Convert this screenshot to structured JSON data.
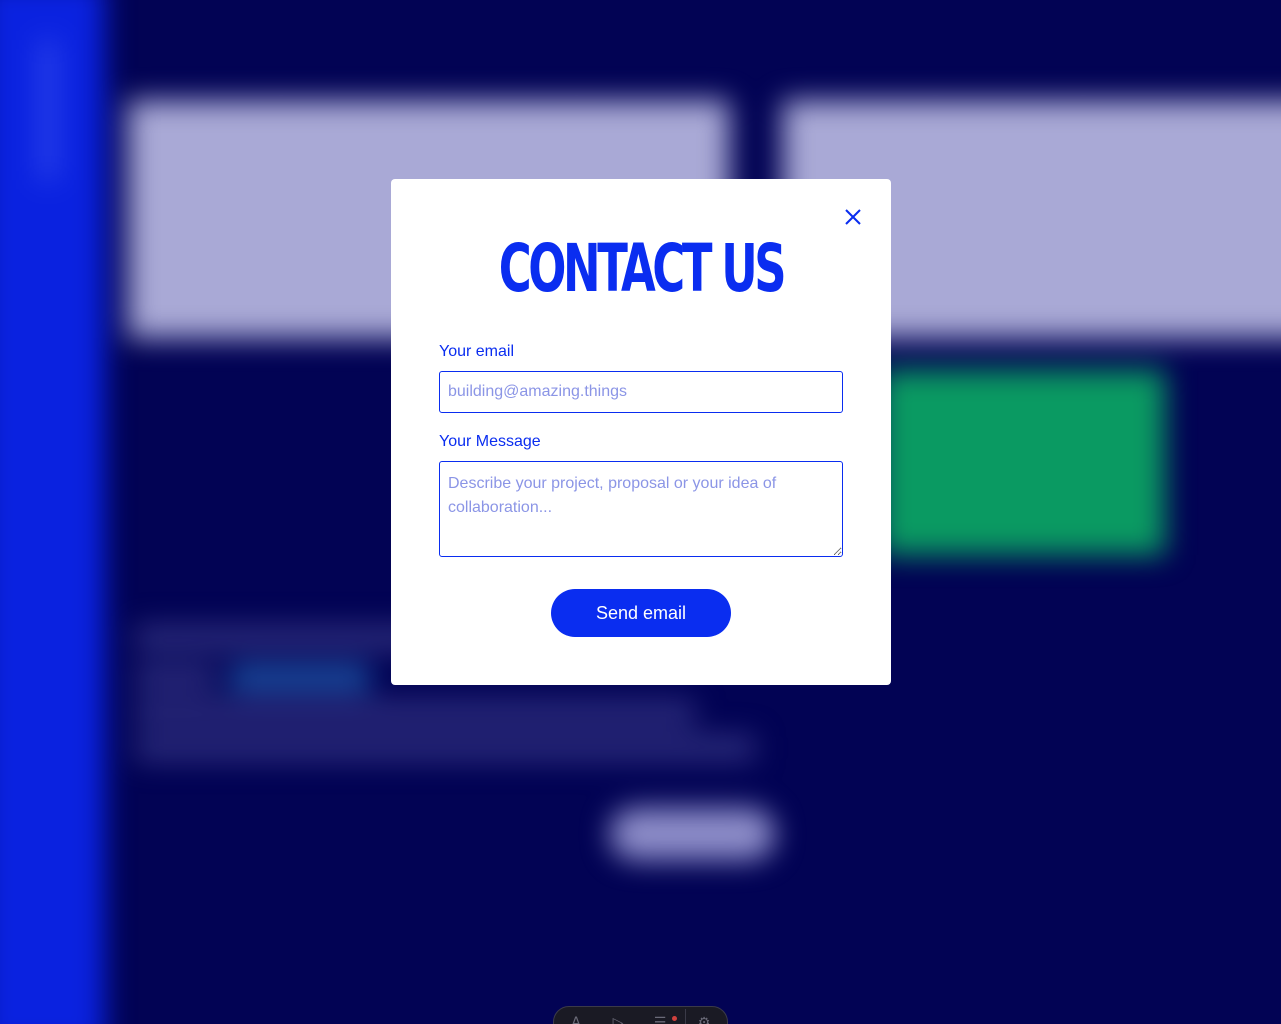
{
  "modal": {
    "title": "CONTACT US",
    "close_icon": "close-icon",
    "email_label": "Your email",
    "email_placeholder": "building@amazing.things",
    "email_value": "",
    "message_label": "Your Message",
    "message_placeholder": "Describe your project, proposal or your idea of collaboration...",
    "message_value": "",
    "send_label": "Send email"
  },
  "dock": {
    "icons": [
      "text-icon",
      "pointer-icon",
      "list-icon",
      "settings-icon"
    ]
  },
  "colors": {
    "accent": "#0a2df0",
    "background": "#020354",
    "sidebar": "#0a22e0",
    "green_block": "#0a9a62"
  }
}
